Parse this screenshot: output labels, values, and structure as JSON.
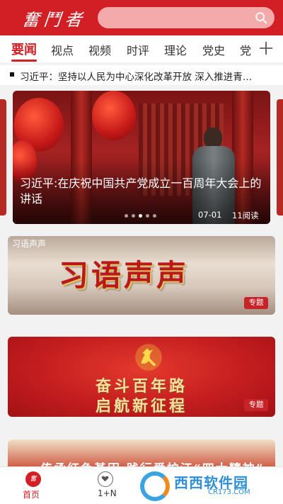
{
  "app": {
    "logo_text": "奮鬥者",
    "search": {
      "placeholder": ""
    }
  },
  "tabs": [
    {
      "label": "要闻",
      "active": true
    },
    {
      "label": "视点"
    },
    {
      "label": "视频"
    },
    {
      "label": "时评"
    },
    {
      "label": "理论"
    },
    {
      "label": "党史"
    },
    {
      "label": "党"
    }
  ],
  "ticker": {
    "text": "习近平：坚持以人民为中心深化改革开放 深入推进青…"
  },
  "hero": {
    "title": "习近平:在庆祝中国共产党成立一百周年大会上的讲话",
    "date": "07-01",
    "reads": "11阅读",
    "slides": 5,
    "active_slide": 3
  },
  "banners": [
    {
      "label": "习语声声",
      "title": "习语声声",
      "tag": "专题"
    },
    {
      "line1": "奋斗百年路",
      "line2": "启航新征程",
      "tag": "专题"
    },
    {
      "text": "传承红色基因 践行爱护江“四大精神”"
    }
  ],
  "bottom_nav": [
    {
      "label": "首页",
      "icon": "home-logo-icon",
      "active": true
    },
    {
      "label": "1+N",
      "icon": "heart-chat-icon"
    }
  ],
  "watermark": {
    "text": "西西软件园",
    "url": "CR173.COM"
  },
  "colors": {
    "brand_red": "#d21f25"
  }
}
